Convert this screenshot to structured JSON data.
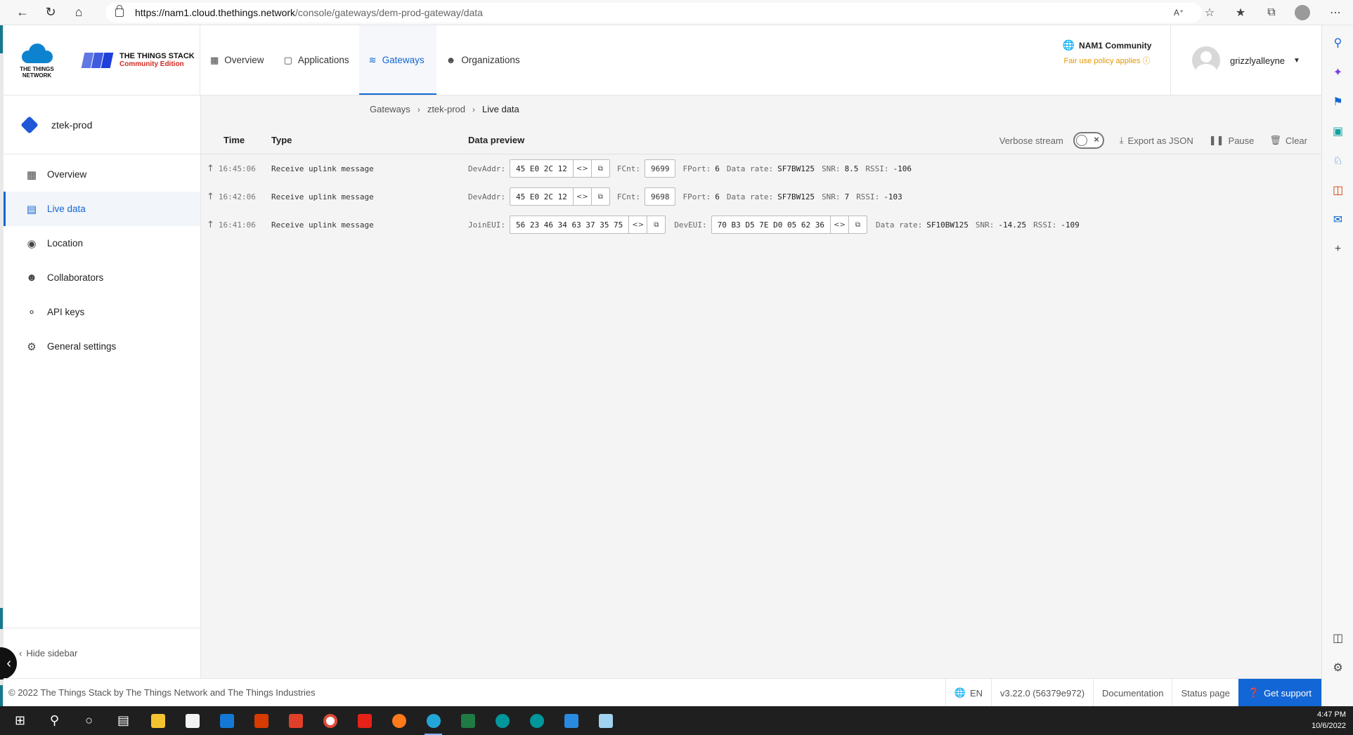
{
  "browser": {
    "url_host": "https://nam1.cloud.thethings.network",
    "url_path": "/console/gateways/dem-prod-gateway/data",
    "back_icon": "arrow-left-icon",
    "reload_icon": "reload-icon",
    "home_icon": "home-icon"
  },
  "brand": {
    "ttn_line1": "THE THINGS",
    "ttn_line2": "NETWORK",
    "stack_title": "THE THINGS STACK",
    "stack_sub": "Community Edition",
    "ttn_color": "#0d83d0",
    "stack_color": "#1e3fd9",
    "edition_color": "#d12b24"
  },
  "topnav": [
    {
      "label": "Overview",
      "icon": "dashboard-icon",
      "active": false
    },
    {
      "label": "Applications",
      "icon": "window-icon",
      "active": false
    },
    {
      "label": "Gateways",
      "icon": "router-icon",
      "active": true
    },
    {
      "label": "Organizations",
      "icon": "people-icon",
      "active": false
    }
  ],
  "cluster": {
    "name": "NAM1 Community",
    "policy": "Fair use policy applies"
  },
  "user": {
    "name": "grizzlyalleyne"
  },
  "sidebar": {
    "gateway_name": "ztek-prod",
    "items": [
      {
        "label": "Overview",
        "icon": "dashboard-icon"
      },
      {
        "label": "Live data",
        "icon": "list-icon"
      },
      {
        "label": "Location",
        "icon": "pin-icon"
      },
      {
        "label": "Collaborators",
        "icon": "people-icon"
      },
      {
        "label": "API keys",
        "icon": "key-icon"
      },
      {
        "label": "General settings",
        "icon": "gear-icon"
      }
    ],
    "hide_label": "Hide sidebar"
  },
  "breadcrumb": [
    "Gateways",
    "ztek-prod",
    "Live data"
  ],
  "table": {
    "col_time": "Time",
    "col_type": "Type",
    "col_preview": "Data preview",
    "verbose_label": "Verbose stream",
    "export_label": "Export as JSON",
    "pause_label": "Pause",
    "clear_label": "Clear"
  },
  "rows": [
    {
      "time": "16:45:06",
      "type": "Receive uplink message",
      "devaddr_label": "DevAddr:",
      "devaddr": "45 E0 2C 12",
      "fcnt_label": "FCnt:",
      "fcnt": "9699",
      "fport_label": "FPort:",
      "fport": "6",
      "datarate_label": "Data rate:",
      "datarate": "SF7BW125",
      "snr_label": "SNR:",
      "snr": "8.5",
      "rssi_label": "RSSI:",
      "rssi": "-106"
    },
    {
      "time": "16:42:06",
      "type": "Receive uplink message",
      "devaddr_label": "DevAddr:",
      "devaddr": "45 E0 2C 12",
      "fcnt_label": "FCnt:",
      "fcnt": "9698",
      "fport_label": "FPort:",
      "fport": "6",
      "datarate_label": "Data rate:",
      "datarate": "SF7BW125",
      "snr_label": "SNR:",
      "snr": "7",
      "rssi_label": "RSSI:",
      "rssi": "-103"
    },
    {
      "time": "16:41:06",
      "type": "Receive uplink message",
      "joineui_label": "JoinEUI:",
      "joineui": "56 23 46 34 63 37 35 75",
      "deveui_label": "DevEUI:",
      "deveui": "70 B3 D5 7E D0 05 62 36",
      "datarate_label": "Data rate:",
      "datarate": "SF10BW125",
      "snr_label": "SNR:",
      "snr": "-14.25",
      "rssi_label": "RSSI:",
      "rssi": "-109"
    }
  ],
  "footer": {
    "copyright": "© 2022 The Things Stack by The Things Network and The Things Industries",
    "language": "EN",
    "version": "v3.22.0 (56379e972)",
    "documentation": "Documentation",
    "status_page": "Status page",
    "support": "Get support"
  },
  "taskbar": {
    "time": "4:47 PM",
    "date": "10/6/2022"
  },
  "colors": {
    "accent": "#1366d6",
    "policy": "#e39700"
  }
}
